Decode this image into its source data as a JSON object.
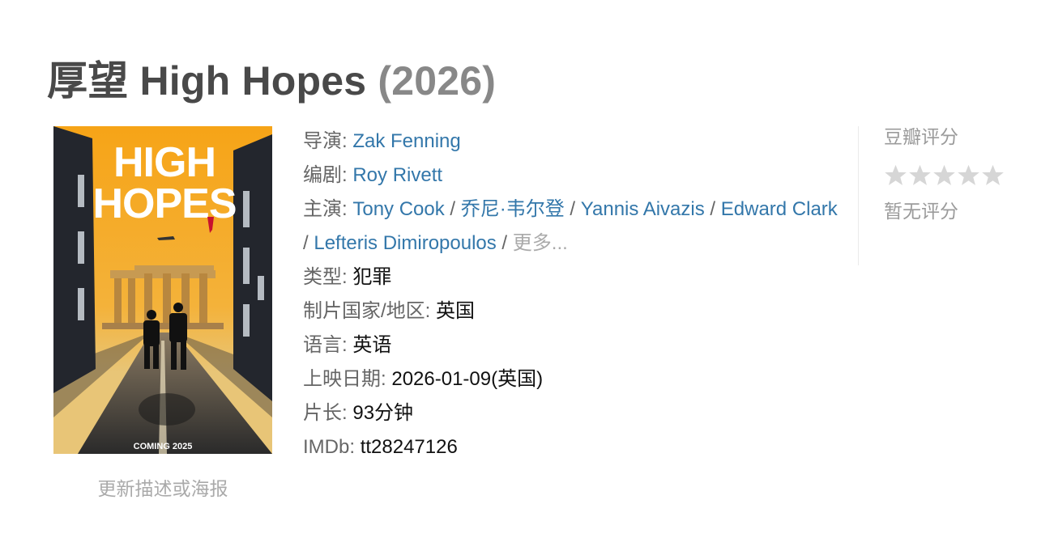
{
  "title": {
    "main": "厚望 High Hopes",
    "year": "(2026)"
  },
  "poster": {
    "title_line1": "HIGH",
    "title_line2": "HOPES",
    "coming": "COMING 2025",
    "colors": {
      "sky": "#f3a51e",
      "title": "#ffffff",
      "accent": "#c8102e"
    }
  },
  "update_link": "更新描述或海报",
  "info": {
    "director": {
      "label": "导演",
      "names": [
        "Zak Fenning"
      ]
    },
    "writer": {
      "label": "编剧",
      "names": [
        "Roy Rivett"
      ]
    },
    "cast": {
      "label": "主演",
      "names": [
        "Tony Cook",
        "乔尼·韦尔登",
        "Yannis Aivazis",
        "Edward Clark",
        "Lefteris Dimiropoulos"
      ],
      "more": "更多..."
    },
    "genre": {
      "label": "类型",
      "value": "犯罪"
    },
    "country": {
      "label": "制片国家/地区",
      "value": "英国"
    },
    "language": {
      "label": "语言",
      "value": "英语"
    },
    "release": {
      "label": "上映日期",
      "value": "2026-01-09(英国)"
    },
    "runtime": {
      "label": "片长",
      "value": "93分钟"
    },
    "imdb": {
      "label": "IMDb",
      "value": "tt28247126"
    }
  },
  "rating": {
    "title": "豆瓣评分",
    "stars": 0,
    "max_stars": 5,
    "star_color_empty": "#d6d6d6",
    "no_rating": "暂无评分"
  },
  "colors": {
    "link": "#3377aa",
    "label": "#666666",
    "heading": "#494949"
  }
}
